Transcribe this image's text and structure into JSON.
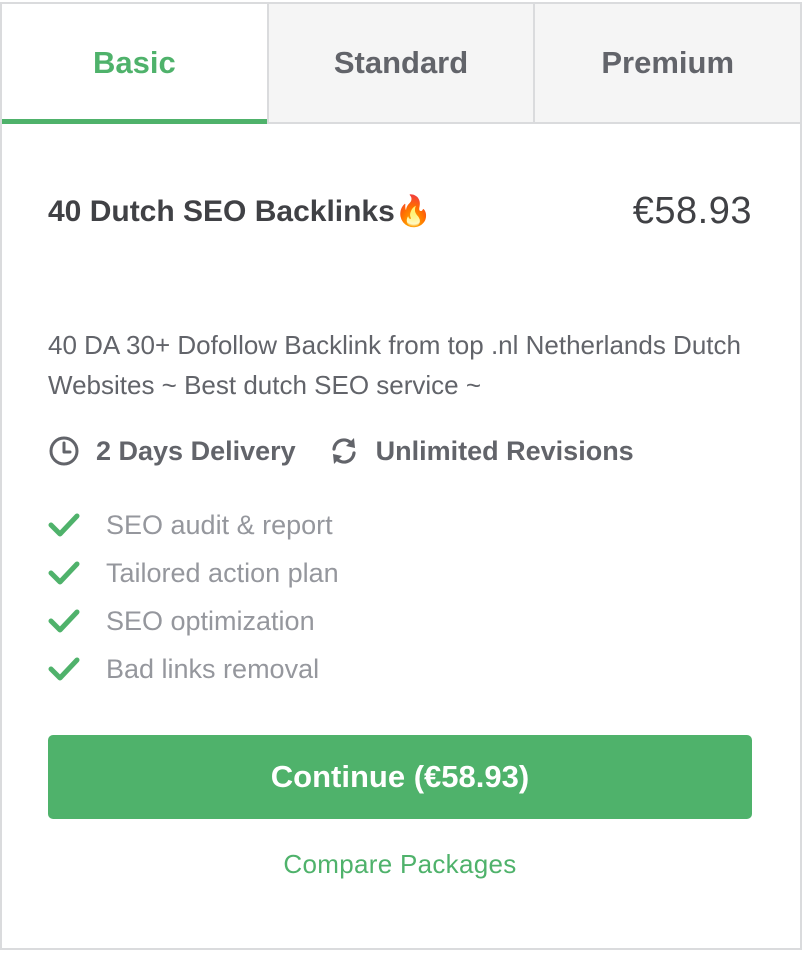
{
  "tabs": [
    {
      "label": "Basic",
      "active": true
    },
    {
      "label": "Standard",
      "active": false
    },
    {
      "label": "Premium",
      "active": false
    }
  ],
  "package": {
    "title": "40 Dutch SEO Backlinks🔥",
    "price": "€58.93",
    "description": "40 DA 30+ Dofollow Backlink from top .nl Netherlands Dutch Websites ~ Best dutch SEO service ~",
    "delivery": "2 Days Delivery",
    "revisions": "Unlimited Revisions",
    "features": [
      "SEO audit & report",
      "Tailored action plan",
      "SEO optimization",
      "Bad links removal"
    ]
  },
  "actions": {
    "continue_label": "Continue (€58.93)",
    "compare_label": "Compare Packages"
  },
  "colors": {
    "accent": "#4fb26b",
    "text_dark": "#404145",
    "text_muted": "#62646a",
    "text_light": "#95979d",
    "border": "#dadbdd"
  },
  "icons": {
    "delivery": "clock-icon",
    "revisions": "refresh-icon",
    "feature": "checkmark-icon"
  }
}
